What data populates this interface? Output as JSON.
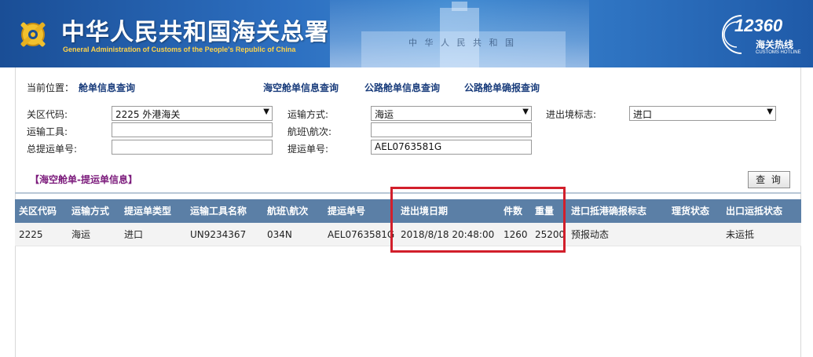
{
  "header": {
    "title_cn": "中华人民共和国海关总署",
    "title_en": "General Administration of Customs of the People's Republic of China",
    "building_text": "中 华 人 民 共 和 国",
    "hotline_number": "12360",
    "hotline_cn": "海关热线",
    "hotline_en": "CUSTOMS HOTLINE"
  },
  "breadcrumb": {
    "label": "当前位置：",
    "current": "舱单信息查询"
  },
  "nav": {
    "sea_air": "海空舱单信息查询",
    "road": "公路舱单信息查询",
    "road_confirm": "公路舱单确报查询"
  },
  "form": {
    "customs_code_label": "关区代码:",
    "customs_code_value": "2225 外港海关",
    "transport_mode_label": "运输方式:",
    "transport_mode_value": "海运",
    "io_flag_label": "进出境标志:",
    "io_flag_value": "进口",
    "vehicle_label": "运输工具:",
    "vehicle_value": "",
    "voyage_label": "航班\\航次:",
    "voyage_value": "",
    "master_bl_label": "总提运单号:",
    "master_bl_value": "",
    "bl_label": "提运单号:",
    "bl_value": "AEL0763581G"
  },
  "section_title": "【海空舱单-提运单信息】",
  "query_button": "查 询",
  "table": {
    "headers": [
      "关区代码",
      "运输方式",
      "提运单类型",
      "运输工具名称",
      "航班\\航次",
      "提运单号",
      "进出境日期",
      "件数",
      "重量",
      "进口抵港确报标志",
      "理货状态",
      "出口运抵状态"
    ],
    "rows": [
      [
        "2225",
        "海运",
        "进口",
        "UN9234367",
        "034N",
        "AEL0763581G",
        "2018/8/18 20:48:00",
        "1260",
        "25200",
        "预报动态",
        "",
        "未运抵"
      ]
    ]
  },
  "colors": {
    "header_bg": "#2d6fc0",
    "table_header_bg": "#5b7fa6",
    "highlight": "#d21f2b",
    "section_title": "#7b1a7b",
    "link": "#1a3d7c"
  }
}
